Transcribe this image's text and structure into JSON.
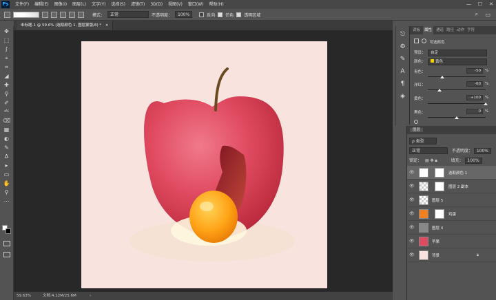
{
  "app": {
    "logo": "Ps"
  },
  "menu": [
    "文件(F)",
    "编辑(E)",
    "图像(I)",
    "图层(L)",
    "文字(Y)",
    "选择(S)",
    "滤镜(T)",
    "3D(D)",
    "视图(V)",
    "窗口(W)",
    "帮助(H)"
  ],
  "window_controls": [
    "—",
    "☐",
    "✕"
  ],
  "options": {
    "mode_label": "模式：",
    "mode_value": "正常",
    "opacity_label": "不透明度：",
    "opacity_value": "100%",
    "reverse": "反向",
    "dither": "仿色",
    "transparency": "透明区域"
  },
  "tools": [
    "✥",
    "⬚",
    "ʃ",
    "⌖",
    "⌗",
    "◢",
    "✚",
    "⚲",
    "✐",
    "⎃",
    "⌫",
    "▦",
    "◐",
    "✎",
    "A",
    "▸",
    "▭",
    "✋",
    "⚲",
    "⋯"
  ],
  "document": {
    "tab_title": "未标题-1 @ 59.6% (选取颜色 1, 图层蒙版/8) *",
    "close": "×",
    "zoom": "59.63%",
    "doc_size": "文档:4.12M/25.6M"
  },
  "properties": {
    "tabs": [
      "调板",
      "属性",
      "通道",
      "路径",
      "动作",
      "字符"
    ],
    "active_tab": "属性",
    "header": "可选颜色",
    "preset_label": "预设：",
    "preset_value": "自定",
    "colors_label": "颜色：",
    "colors_value": "黄色",
    "sliders": [
      {
        "label": "青色：",
        "value": "-50",
        "unit": "%",
        "pct": 0.25
      },
      {
        "label": "洋红：",
        "value": "-60",
        "unit": "%",
        "pct": 0.2
      },
      {
        "label": "黄色：",
        "value": "+100",
        "unit": "%",
        "pct": 1.0
      },
      {
        "label": "黑色：",
        "value": "0",
        "unit": "%",
        "pct": 0.5
      }
    ]
  },
  "layers": {
    "title": "图层",
    "kind_label": "ρ 类型",
    "blend_mode": "正常",
    "opacity_label": "不透明度：",
    "opacity_value": "100%",
    "lock_label": "锁定：",
    "fill_label": "填充：",
    "fill_value": "100%",
    "items": [
      {
        "name": "选取颜色 1",
        "selected": true,
        "mask": true
      },
      {
        "name": "图层 2 副本",
        "selected": false,
        "mask": true
      },
      {
        "name": "图层 5",
        "selected": false,
        "mask": false
      },
      {
        "name": "鸡蛋",
        "selected": false,
        "mask": true
      },
      {
        "name": "图层 4",
        "selected": false,
        "mask": false
      },
      {
        "name": "苹果",
        "selected": false,
        "mask": false
      },
      {
        "name": "背景",
        "selected": false,
        "mask": false,
        "locked": true
      }
    ]
  }
}
